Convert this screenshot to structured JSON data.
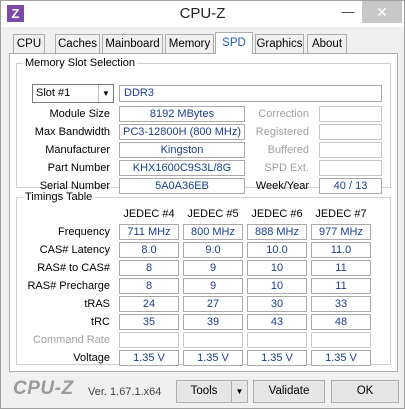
{
  "window": {
    "title": "CPU-Z",
    "minimize_glyph": "—",
    "close_glyph": "✕",
    "app_icon_letter": "Z"
  },
  "tabs": [
    {
      "label": "CPU",
      "active": false
    },
    {
      "label": "Caches",
      "active": false
    },
    {
      "label": "Mainboard",
      "active": false
    },
    {
      "label": "Memory",
      "active": false
    },
    {
      "label": "SPD",
      "active": true
    },
    {
      "label": "Graphics",
      "active": false
    },
    {
      "label": "About",
      "active": false
    }
  ],
  "slot": {
    "group_title": "Memory Slot Selection",
    "selected": "Slot #1",
    "type": "DDR3",
    "module_size": {
      "label": "Module Size",
      "value": "8192 MBytes"
    },
    "max_bandwidth": {
      "label": "Max Bandwidth",
      "value": "PC3-12800H (800 MHz)"
    },
    "manufacturer": {
      "label": "Manufacturer",
      "value": "Kingston"
    },
    "part_number": {
      "label": "Part Number",
      "value": "KHX1600C9S3L/8G"
    },
    "serial_number": {
      "label": "Serial Number",
      "value": "5A0A36EB"
    },
    "correction": {
      "label": "Correction",
      "value": ""
    },
    "registered": {
      "label": "Registered",
      "value": ""
    },
    "buffered": {
      "label": "Buffered",
      "value": ""
    },
    "spd_ext": {
      "label": "SPD Ext.",
      "value": ""
    },
    "week_year": {
      "label": "Week/Year",
      "value": "40 / 13"
    }
  },
  "timings": {
    "group_title": "Timings Table",
    "columns": [
      "JEDEC #4",
      "JEDEC #5",
      "JEDEC #6",
      "JEDEC #7"
    ],
    "rows": [
      {
        "label": "Frequency",
        "dim": false,
        "values": [
          "711 MHz",
          "800 MHz",
          "888 MHz",
          "977 MHz"
        ]
      },
      {
        "label": "CAS# Latency",
        "dim": false,
        "values": [
          "8.0",
          "9.0",
          "10.0",
          "11.0"
        ]
      },
      {
        "label": "RAS# to CAS#",
        "dim": false,
        "values": [
          "8",
          "9",
          "10",
          "11"
        ]
      },
      {
        "label": "RAS# Precharge",
        "dim": false,
        "values": [
          "8",
          "9",
          "10",
          "11"
        ]
      },
      {
        "label": "tRAS",
        "dim": false,
        "values": [
          "24",
          "27",
          "30",
          "33"
        ]
      },
      {
        "label": "tRC",
        "dim": false,
        "values": [
          "35",
          "39",
          "43",
          "48"
        ]
      },
      {
        "label": "Command Rate",
        "dim": true,
        "values": [
          "",
          "",
          "",
          ""
        ]
      },
      {
        "label": "Voltage",
        "dim": false,
        "values": [
          "1.35 V",
          "1.35 V",
          "1.35 V",
          "1.35 V"
        ]
      }
    ]
  },
  "footer": {
    "brand": "CPU-Z",
    "version": "Ver. 1.67.1.x64",
    "tools_label": "Tools",
    "validate_label": "Validate",
    "ok_label": "OK"
  }
}
